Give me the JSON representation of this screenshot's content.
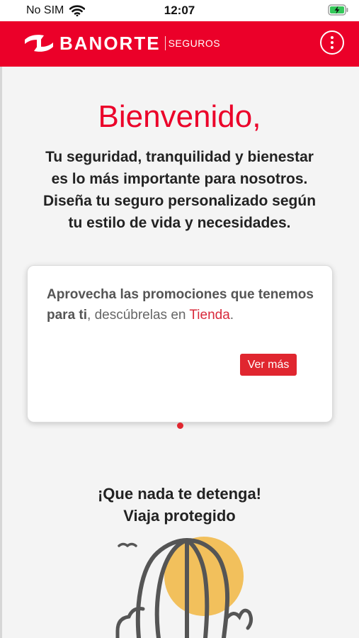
{
  "status_bar": {
    "carrier": "No SIM",
    "time": "12:07"
  },
  "header": {
    "brand": "BANORTE",
    "brand_sub": "SEGUROS"
  },
  "welcome": {
    "title": "Bienvenido,",
    "lines": [
      "Tu seguridad, tranquilidad y bienestar",
      "es lo más importante para nosotros.",
      "Diseña tu seguro personalizado según",
      "tu estilo de vida y necesidades."
    ]
  },
  "promo_card": {
    "bold_text": "Aprovecha las promociones que tenemos para ti",
    "normal_text": ", descúbrelas en ",
    "link_text": "Tienda",
    "end_text": ".",
    "button_label": "Ver más"
  },
  "travel": {
    "line1": "¡Que nada te detenga!",
    "line2": "Viaja protegido"
  },
  "colors": {
    "brand_red": "#eb0029",
    "button_red": "#e0262f",
    "sun_yellow": "#f2c05c",
    "icon_gray": "#555555"
  },
  "icons": {
    "wifi": "wifi-icon",
    "battery": "battery-charging-icon",
    "menu": "more-vertical-icon"
  }
}
